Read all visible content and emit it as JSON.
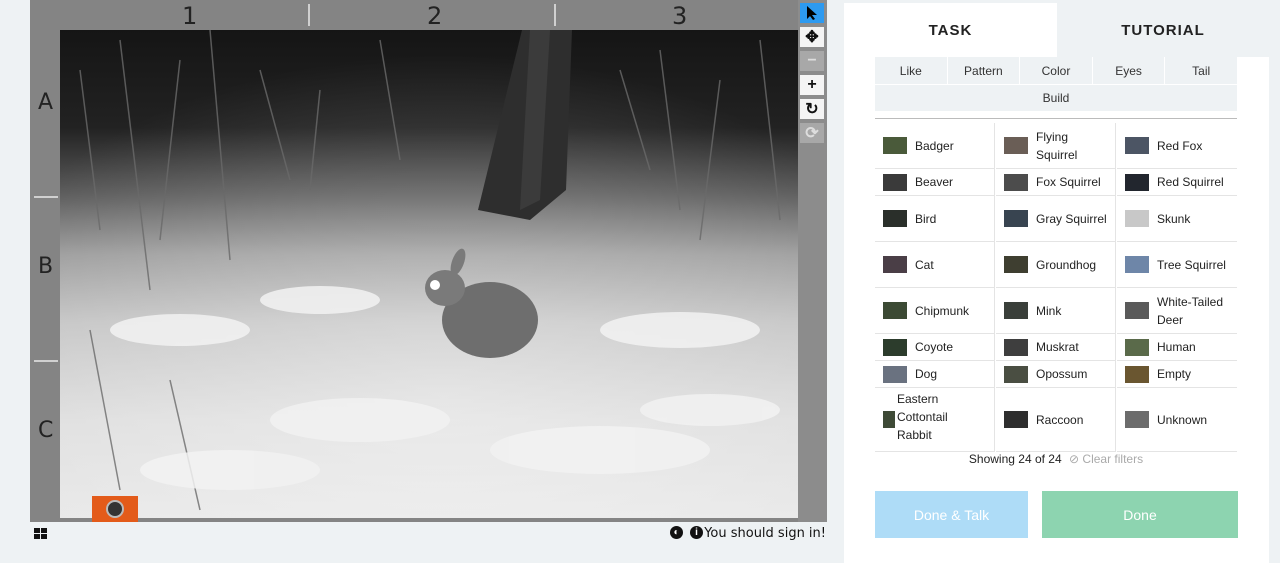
{
  "viewer": {
    "columns": [
      "1",
      "2",
      "3"
    ],
    "rows": [
      "A",
      "B",
      "C"
    ],
    "tools": [
      "pointer-icon",
      "pan-icon",
      "zoom-out-icon",
      "zoom-in-icon",
      "rotate-icon",
      "reset-icon"
    ],
    "signin_text": "You should sign in!"
  },
  "tabs": {
    "task": "TASK",
    "tutorial": "TUTORIAL"
  },
  "filters": [
    "Like",
    "Pattern",
    "Color",
    "Eyes",
    "Tail",
    "Build"
  ],
  "species": [
    {
      "name": "Badger",
      "thumb": "#4a5a3a"
    },
    {
      "name": "Flying Squirrel",
      "thumb": "#6a5e56"
    },
    {
      "name": "Red Fox",
      "thumb": "#4c5564"
    },
    {
      "name": "Beaver",
      "thumb": "#3a3a3a"
    },
    {
      "name": "Fox Squirrel",
      "thumb": "#4c4c4c"
    },
    {
      "name": "Red Squirrel",
      "thumb": "#22262e"
    },
    {
      "name": "Bird",
      "thumb": "#2a2f2a"
    },
    {
      "name": "Gray Squirrel",
      "thumb": "#384450"
    },
    {
      "name": "Skunk",
      "thumb": "#c8c8c8"
    },
    {
      "name": "Cat",
      "thumb": "#4a3e46"
    },
    {
      "name": "Groundhog",
      "thumb": "#3e3e30"
    },
    {
      "name": "Tree Squirrel",
      "thumb": "#6e86a8"
    },
    {
      "name": "Chipmunk",
      "thumb": "#3c4a34"
    },
    {
      "name": "Mink",
      "thumb": "#3a3f3a"
    },
    {
      "name": "White-Tailed Deer",
      "thumb": "#5a5a5a"
    },
    {
      "name": "Coyote",
      "thumb": "#2c3c2c"
    },
    {
      "name": "Muskrat",
      "thumb": "#3e3e3e"
    },
    {
      "name": "Human",
      "thumb": "#5a6a4a"
    },
    {
      "name": "Dog",
      "thumb": "#6a7280"
    },
    {
      "name": "Opossum",
      "thumb": "#4a4e42"
    },
    {
      "name": "Empty",
      "thumb": "#6a5630"
    },
    {
      "name": "Eastern Cottontail Rabbit",
      "thumb": "#3e4a36"
    },
    {
      "name": "Raccoon",
      "thumb": "#2e2e2e"
    },
    {
      "name": "Unknown",
      "thumb": "#6c6c6c"
    }
  ],
  "showing": "Showing 24 of 24",
  "clear_filters": "Clear filters",
  "buttons": {
    "done_talk": "Done & Talk",
    "done": "Done"
  },
  "colors": {
    "active_tool": "#2d9af0",
    "done_talk": "#aedcf7",
    "done": "#8dd4b0",
    "camera_badge": "#e35b1a"
  }
}
